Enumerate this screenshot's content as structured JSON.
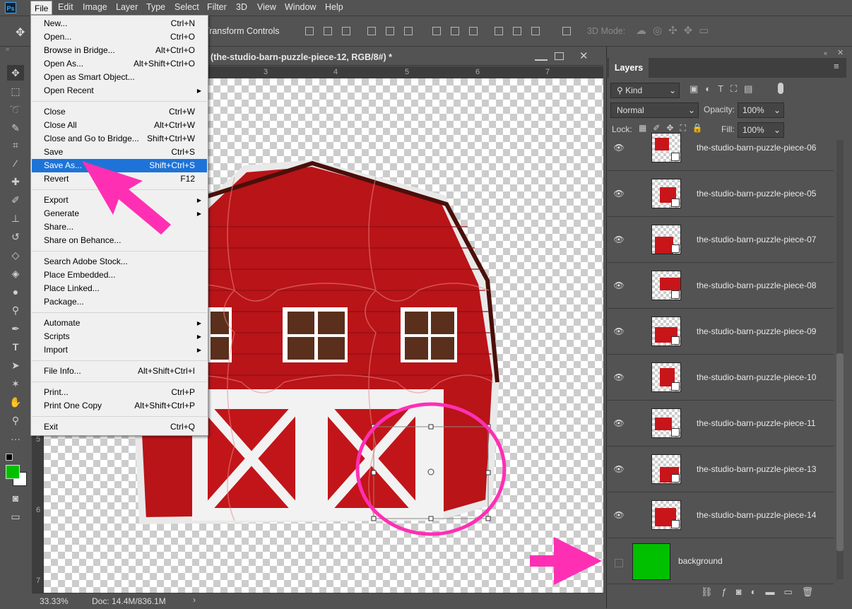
{
  "app": {
    "logo_text": "Ps"
  },
  "menubar": [
    "File",
    "Edit",
    "Image",
    "Layer",
    "Type",
    "Select",
    "Filter",
    "3D",
    "View",
    "Window",
    "Help"
  ],
  "options_bar": {
    "transform_controls": "Transform Controls",
    "mode3d": "3D Mode:"
  },
  "document": {
    "title": "(the-studio-barn-puzzle-piece-12, RGB/8#) *",
    "ruler_top": [
      "3",
      "4",
      "5",
      "6",
      "7"
    ],
    "ruler_left": [
      "5",
      "6",
      "7"
    ],
    "zoom": "33.33%",
    "doc_size": "Doc: 14.4M/836.1M"
  },
  "file_menu": {
    "groups": [
      [
        {
          "label": "New...",
          "shortcut": "Ctrl+N"
        },
        {
          "label": "Open...",
          "shortcut": "Ctrl+O"
        },
        {
          "label": "Browse in Bridge...",
          "shortcut": "Alt+Ctrl+O"
        },
        {
          "label": "Open As...",
          "shortcut": "Alt+Shift+Ctrl+O"
        },
        {
          "label": "Open as Smart Object...",
          "shortcut": ""
        },
        {
          "label": "Open Recent",
          "shortcut": "",
          "submenu": true
        }
      ],
      [
        {
          "label": "Close",
          "shortcut": "Ctrl+W"
        },
        {
          "label": "Close All",
          "shortcut": "Alt+Ctrl+W"
        },
        {
          "label": "Close and Go to Bridge...",
          "shortcut": "Shift+Ctrl+W"
        },
        {
          "label": "Save",
          "shortcut": "Ctrl+S"
        },
        {
          "label": "Save As...",
          "shortcut": "Shift+Ctrl+S",
          "highlighted": true
        },
        {
          "label": "Revert",
          "shortcut": "F12"
        }
      ],
      [
        {
          "label": "Export",
          "shortcut": "",
          "submenu": true
        },
        {
          "label": "Generate",
          "shortcut": "",
          "submenu": true
        },
        {
          "label": "Share...",
          "shortcut": ""
        },
        {
          "label": "Share on Behance...",
          "shortcut": ""
        }
      ],
      [
        {
          "label": "Search Adobe Stock...",
          "shortcut": ""
        },
        {
          "label": "Place Embedded...",
          "shortcut": ""
        },
        {
          "label": "Place Linked...",
          "shortcut": ""
        },
        {
          "label": "Package...",
          "shortcut": ""
        }
      ],
      [
        {
          "label": "Automate",
          "shortcut": "",
          "submenu": true
        },
        {
          "label": "Scripts",
          "shortcut": "",
          "submenu": true
        },
        {
          "label": "Import",
          "shortcut": "",
          "submenu": true
        }
      ],
      [
        {
          "label": "File Info...",
          "shortcut": "Alt+Shift+Ctrl+I"
        }
      ],
      [
        {
          "label": "Print...",
          "shortcut": "Ctrl+P"
        },
        {
          "label": "Print One Copy",
          "shortcut": "Alt+Shift+Ctrl+P"
        }
      ],
      [
        {
          "label": "Exit",
          "shortcut": "Ctrl+Q"
        }
      ]
    ]
  },
  "layers_panel": {
    "tab": "Layers",
    "filter_kind": "Kind",
    "blend_mode": "Normal",
    "opacity_label": "Opacity:",
    "opacity_value": "100%",
    "lock_label": "Lock:",
    "fill_label": "Fill:",
    "fill_value": "100%",
    "layers": [
      {
        "name": "the-studio-barn-puzzle-piece-06",
        "visible": true
      },
      {
        "name": "the-studio-barn-puzzle-piece-05",
        "visible": true
      },
      {
        "name": "the-studio-barn-puzzle-piece-07",
        "visible": true
      },
      {
        "name": "the-studio-barn-puzzle-piece-08",
        "visible": true
      },
      {
        "name": "the-studio-barn-puzzle-piece-09",
        "visible": true
      },
      {
        "name": "the-studio-barn-puzzle-piece-10",
        "visible": true
      },
      {
        "name": "the-studio-barn-puzzle-piece-11",
        "visible": true
      },
      {
        "name": "the-studio-barn-puzzle-piece-13",
        "visible": true
      },
      {
        "name": "the-studio-barn-puzzle-piece-14",
        "visible": true
      },
      {
        "name": "background",
        "visible": false
      }
    ]
  },
  "colors": {
    "foreground": "#00c000",
    "background": "#ffffff",
    "accent": "#ff2fb4",
    "barn_red": "#c8151a",
    "selection": "#1e73d8"
  }
}
